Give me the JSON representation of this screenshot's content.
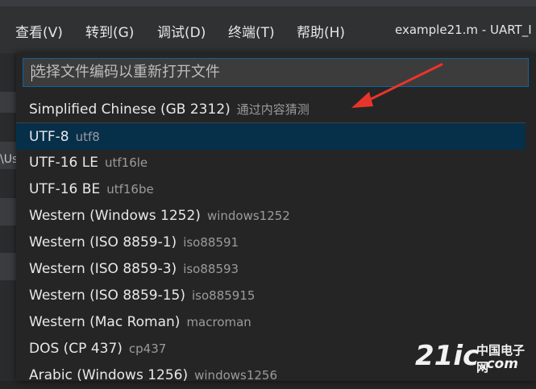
{
  "menubar": {
    "items": [
      {
        "label": "查看(V)"
      },
      {
        "label": "转到(G)"
      },
      {
        "label": "调试(D)"
      },
      {
        "label": "终端(T)"
      },
      {
        "label": "帮助(H)"
      }
    ],
    "window_title": "example21.m - UART_I"
  },
  "left_strip": {
    "partial_text": "\\Us"
  },
  "quickpick": {
    "placeholder": "选择文件编码以重新打开文件",
    "items": [
      {
        "label": "Simplified Chinese (GB 2312)",
        "description": "通过内容猜测"
      },
      {
        "label": "UTF-8",
        "description": "utf8"
      },
      {
        "label": "UTF-16 LE",
        "description": "utf16le"
      },
      {
        "label": "UTF-16 BE",
        "description": "utf16be"
      },
      {
        "label": "Western (Windows 1252)",
        "description": "windows1252"
      },
      {
        "label": "Western (ISO 8859-1)",
        "description": "iso88591"
      },
      {
        "label": "Western (ISO 8859-3)",
        "description": "iso88593"
      },
      {
        "label": "Western (ISO 8859-15)",
        "description": "iso885915"
      },
      {
        "label": "Western (Mac Roman)",
        "description": "macroman"
      },
      {
        "label": "DOS (CP 437)",
        "description": "cp437"
      },
      {
        "label": "Arabic (Windows 1256)",
        "description": "windows1256"
      }
    ],
    "selected_item": "UTF-8"
  },
  "annotation": {
    "arrow_color": "#e8352b"
  },
  "watermark": {
    "main": "21ic",
    "chinese": "中国电子网",
    "domain": ".com"
  },
  "colors": {
    "selection": "#062f4a",
    "input_border": "#0e639c",
    "panel_background": "#252526"
  }
}
